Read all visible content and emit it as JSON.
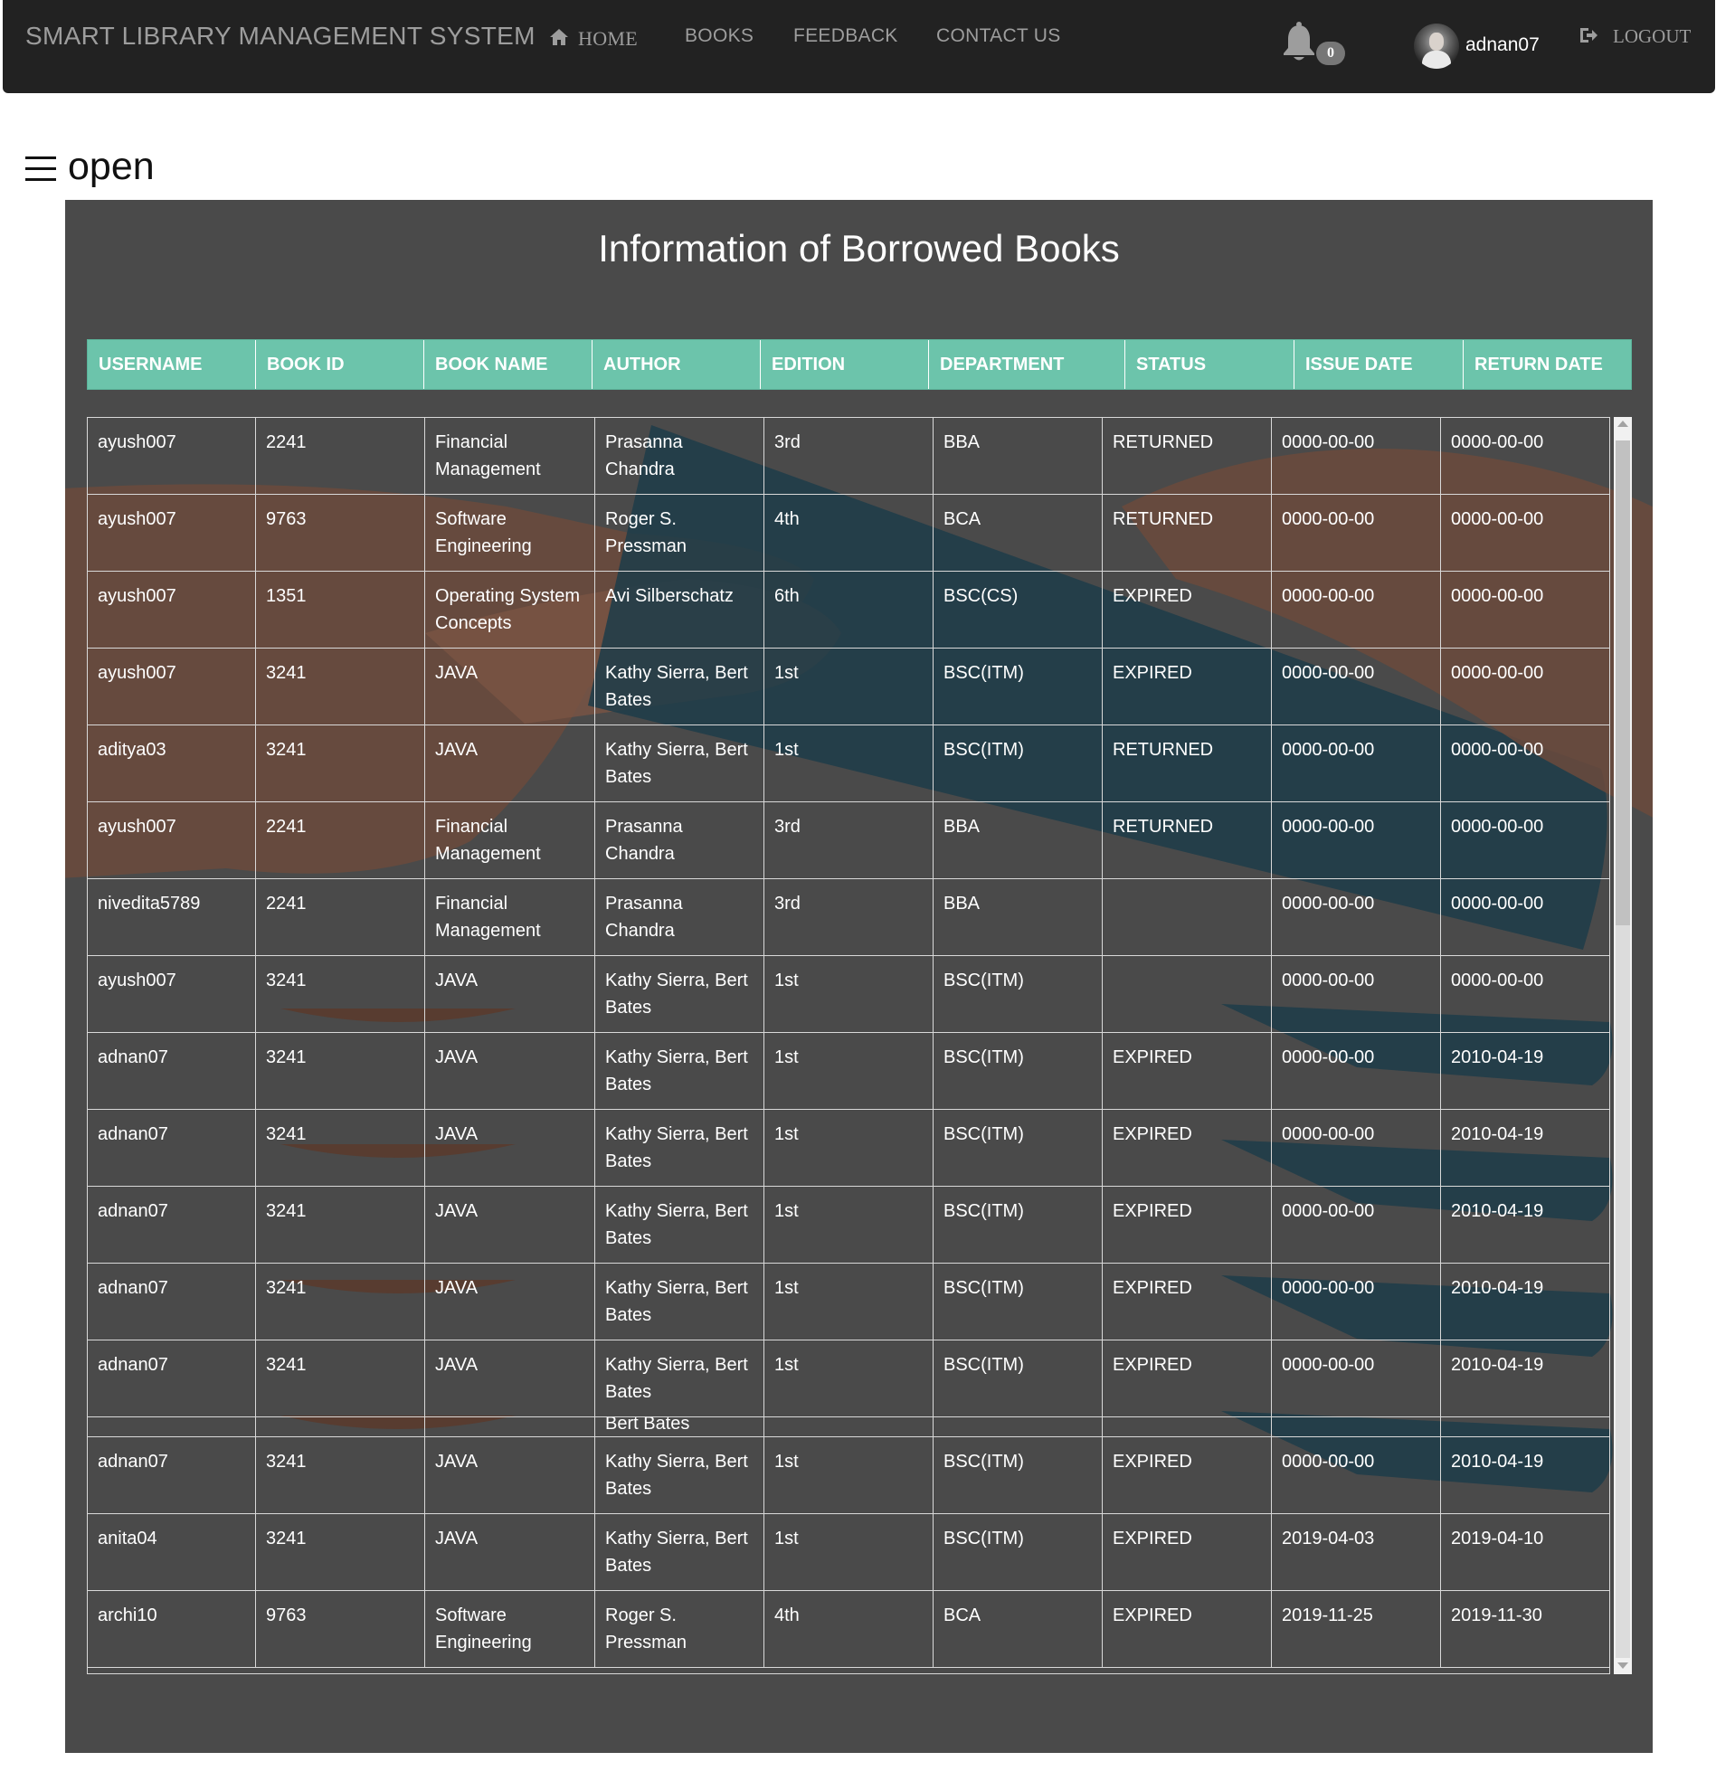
{
  "navbar": {
    "brand": "SMART LIBRARY MANAGEMENT SYSTEM",
    "home": "HOME",
    "books": "BOOKS",
    "feedback": "FEEDBACK",
    "contact": "CONTACT US",
    "notification_count": "0",
    "username": "adnan07",
    "logout": "LOGOUT"
  },
  "sidebar_toggle": {
    "label": "open"
  },
  "page": {
    "title": "Information of Borrowed Books"
  },
  "table": {
    "columns": [
      "USERNAME",
      "BOOK ID",
      "BOOK NAME",
      "AUTHOR",
      "EDITION",
      "DEPARTMENT",
      "STATUS",
      "ISSUE DATE",
      "RETURN DATE"
    ],
    "rows": [
      {
        "username": "ayush007",
        "book_id": "2241",
        "book_name": "Financial Management",
        "author": "Prasanna Chandra",
        "edition": "3rd",
        "department": "BBA",
        "status": "RETURNED",
        "issue_date": "0000-00-00",
        "return_date": "0000-00-00"
      },
      {
        "username": "ayush007",
        "book_id": "9763",
        "book_name": "Software Engineering",
        "author": "Roger S. Pressman",
        "edition": "4th",
        "department": "BCA",
        "status": "RETURNED",
        "issue_date": "0000-00-00",
        "return_date": "0000-00-00"
      },
      {
        "username": "ayush007",
        "book_id": "1351",
        "book_name": "Operating System Concepts",
        "author": "Avi Silberschatz",
        "edition": "6th",
        "department": "BSC(CS)",
        "status": "EXPIRED",
        "issue_date": "0000-00-00",
        "return_date": "0000-00-00"
      },
      {
        "username": "ayush007",
        "book_id": "3241",
        "book_name": "JAVA",
        "author": "Kathy Sierra, Bert Bates",
        "edition": "1st",
        "department": "BSC(ITM)",
        "status": "EXPIRED",
        "issue_date": "0000-00-00",
        "return_date": "0000-00-00"
      },
      {
        "username": "aditya03",
        "book_id": "3241",
        "book_name": "JAVA",
        "author": "Kathy Sierra, Bert Bates",
        "edition": "1st",
        "department": "BSC(ITM)",
        "status": "RETURNED",
        "issue_date": "0000-00-00",
        "return_date": "0000-00-00"
      },
      {
        "username": "ayush007",
        "book_id": "2241",
        "book_name": "Financial Management",
        "author": "Prasanna Chandra",
        "edition": "3rd",
        "department": "BBA",
        "status": "RETURNED",
        "issue_date": "0000-00-00",
        "return_date": "0000-00-00"
      },
      {
        "username": "nivedita5789",
        "book_id": "2241",
        "book_name": "Financial Management",
        "author": "Prasanna Chandra",
        "edition": "3rd",
        "department": "BBA",
        "status": "",
        "issue_date": "0000-00-00",
        "return_date": "0000-00-00"
      },
      {
        "username": "ayush007",
        "book_id": "3241",
        "book_name": "JAVA",
        "author": "Kathy Sierra, Bert Bates",
        "edition": "1st",
        "department": "BSC(ITM)",
        "status": "",
        "issue_date": "0000-00-00",
        "return_date": "0000-00-00"
      },
      {
        "username": "adnan07",
        "book_id": "3241",
        "book_name": "JAVA",
        "author": "Kathy Sierra, Bert Bates",
        "edition": "1st",
        "department": "BSC(ITM)",
        "status": "EXPIRED",
        "issue_date": "0000-00-00",
        "return_date": "2010-04-19"
      },
      {
        "username": "adnan07",
        "book_id": "3241",
        "book_name": "JAVA",
        "author": "Kathy Sierra, Bert Bates",
        "edition": "1st",
        "department": "BSC(ITM)",
        "status": "EXPIRED",
        "issue_date": "0000-00-00",
        "return_date": "2010-04-19"
      },
      {
        "username": "adnan07",
        "book_id": "3241",
        "book_name": "JAVA",
        "author": "Kathy Sierra, Bert Bates",
        "edition": "1st",
        "department": "BSC(ITM)",
        "status": "EXPIRED",
        "issue_date": "0000-00-00",
        "return_date": "2010-04-19"
      },
      {
        "username": "adnan07",
        "book_id": "3241",
        "book_name": "JAVA",
        "author": "Kathy Sierra, Bert Bates",
        "edition": "1st",
        "department": "BSC(ITM)",
        "status": "EXPIRED",
        "issue_date": "0000-00-00",
        "return_date": "2010-04-19"
      },
      {
        "username": "adnan07",
        "book_id": "3241",
        "book_name": "JAVA",
        "author": "Kathy Sierra, Bert Bates",
        "edition": "1st",
        "department": "BSC(ITM)",
        "status": "EXPIRED",
        "issue_date": "0000-00-00",
        "return_date": "2010-04-19"
      },
      {
        "username": "",
        "book_id": "",
        "book_name": "",
        "author": "Bert Bates",
        "edition": "",
        "department": "",
        "status": "",
        "issue_date": "",
        "return_date": ""
      },
      {
        "username": "adnan07",
        "book_id": "3241",
        "book_name": "JAVA",
        "author": "Kathy Sierra, Bert Bates",
        "edition": "1st",
        "department": "BSC(ITM)",
        "status": "EXPIRED",
        "issue_date": "0000-00-00",
        "return_date": "2010-04-19"
      },
      {
        "username": "anita04",
        "book_id": "3241",
        "book_name": "JAVA",
        "author": "Kathy Sierra, Bert Bates",
        "edition": "1st",
        "department": "BSC(ITM)",
        "status": "EXPIRED",
        "issue_date": "2019-04-03",
        "return_date": "2019-04-10"
      },
      {
        "username": "archi10",
        "book_id": "9763",
        "book_name": "Software Engineering",
        "author": "Roger S. Pressman",
        "edition": "4th",
        "department": "BCA",
        "status": "EXPIRED",
        "issue_date": "2019-11-25",
        "return_date": "2019-11-30"
      }
    ]
  },
  "colors": {
    "navbar_bg": "#222222",
    "panel_bg": "#4a4a4a",
    "header_bg": "#6cc4ab",
    "text_light": "#ffffff"
  }
}
